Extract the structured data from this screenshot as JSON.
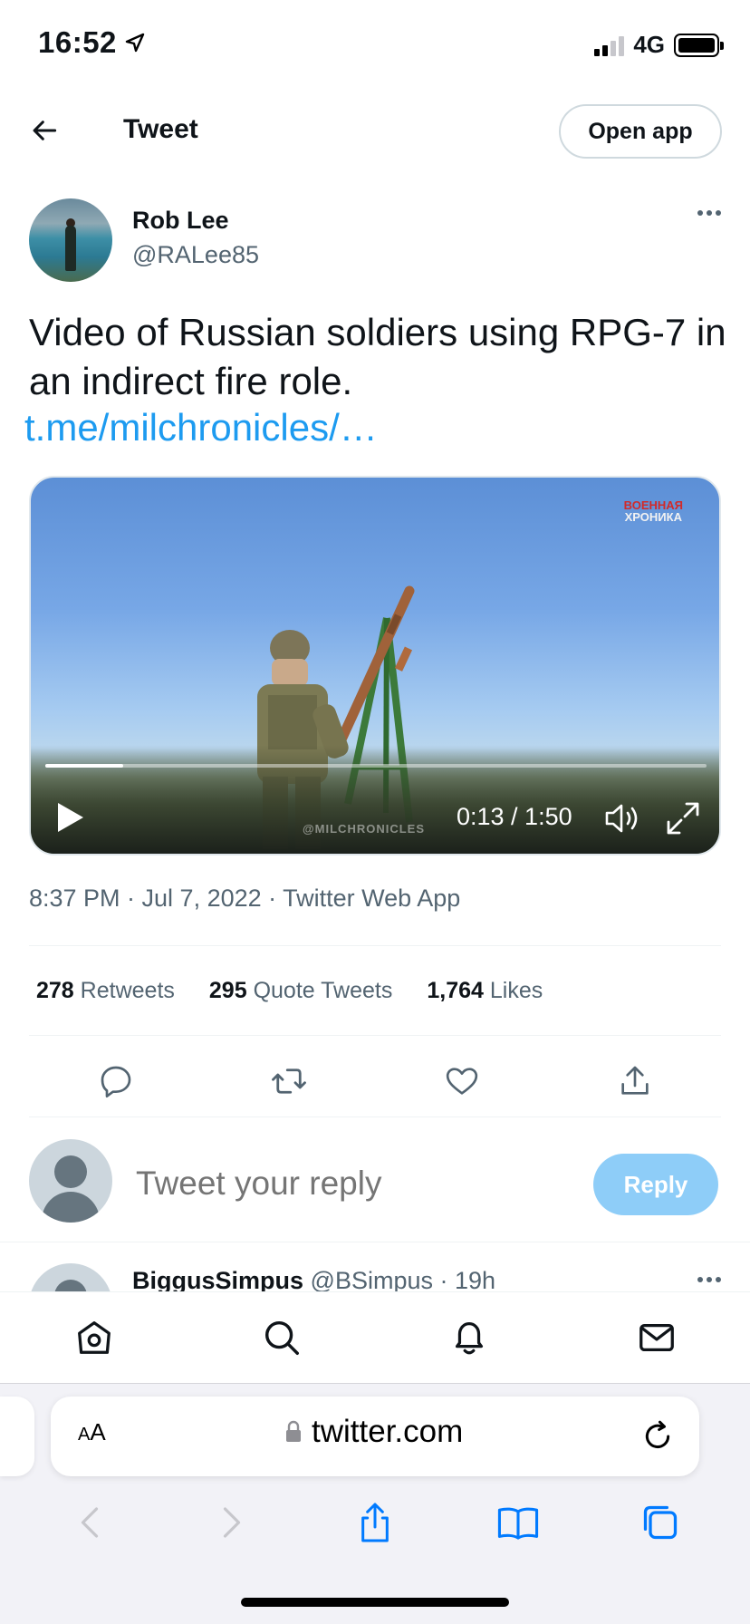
{
  "status_bar": {
    "time": "16:52",
    "network": "4G"
  },
  "header": {
    "title": "Tweet",
    "open_app_label": "Open app"
  },
  "tweet": {
    "author_name": "Rob Lee",
    "author_handle": "@RALee85",
    "text": "Video of Russian soldiers using RPG-7 in an indirect fire role.",
    "link_text": "t.me/milchronicles/…",
    "video": {
      "watermark_line1": "ВОЕННАЯ",
      "watermark_line2": "ХРОНИКА",
      "watermark_bottom": "@MILCHRONICLES",
      "time_display": "0:13 / 1:50",
      "progress": 0.118
    },
    "meta": "8:37 PM · Jul 7, 2022 · Twitter Web App",
    "stats": {
      "retweets_count": "278",
      "retweets_label": "Retweets",
      "quotes_count": "295",
      "quotes_label": "Quote Tweets",
      "likes_count": "1,764",
      "likes_label": "Likes"
    }
  },
  "reply": {
    "placeholder": "Tweet your reply",
    "button_label": "Reply"
  },
  "next_tweet": {
    "name": "BiggusSimpus",
    "handle_time": "@BSimpus · 19h"
  },
  "safari": {
    "aa_label_small": "A",
    "aa_label_large": "A",
    "url": "twitter.com"
  },
  "colors": {
    "accent": "#1d9bf0",
    "reply_button": "#8ecdf8",
    "secondary_text": "#536471"
  },
  "icons": {
    "nav": [
      "home-icon",
      "search-icon",
      "bell-icon",
      "mail-icon"
    ],
    "actions": [
      "reply-icon",
      "retweet-icon",
      "like-icon",
      "share-icon"
    ]
  }
}
